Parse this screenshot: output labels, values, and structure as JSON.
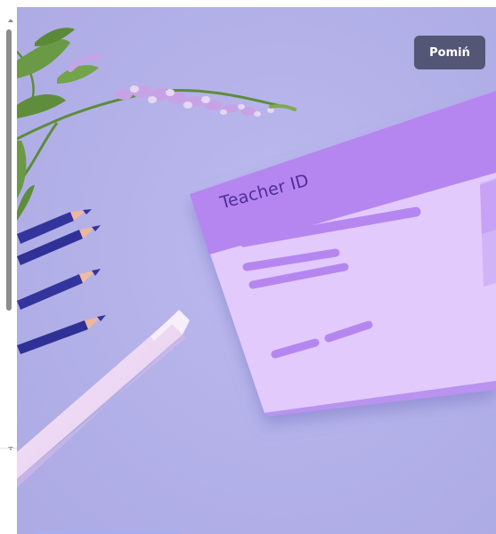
{
  "hero": {
    "card_title": "Teacher ID",
    "skip_button_label": "Pomiń"
  },
  "scrollbar": {
    "thumb_position": 0.0
  },
  "colors": {
    "background": "#b5b3ea",
    "card_header": "#b586f0",
    "card_body": "#e3cafc",
    "card_lines": "#b586f0",
    "title_text": "#4f2d97",
    "button_bg": "#545676",
    "pencil": "#33349c",
    "pen": "#efd9f3"
  },
  "icons": {
    "flower": "lavender-sprig",
    "pencils": "blue-pencils",
    "pen": "white-pen"
  }
}
